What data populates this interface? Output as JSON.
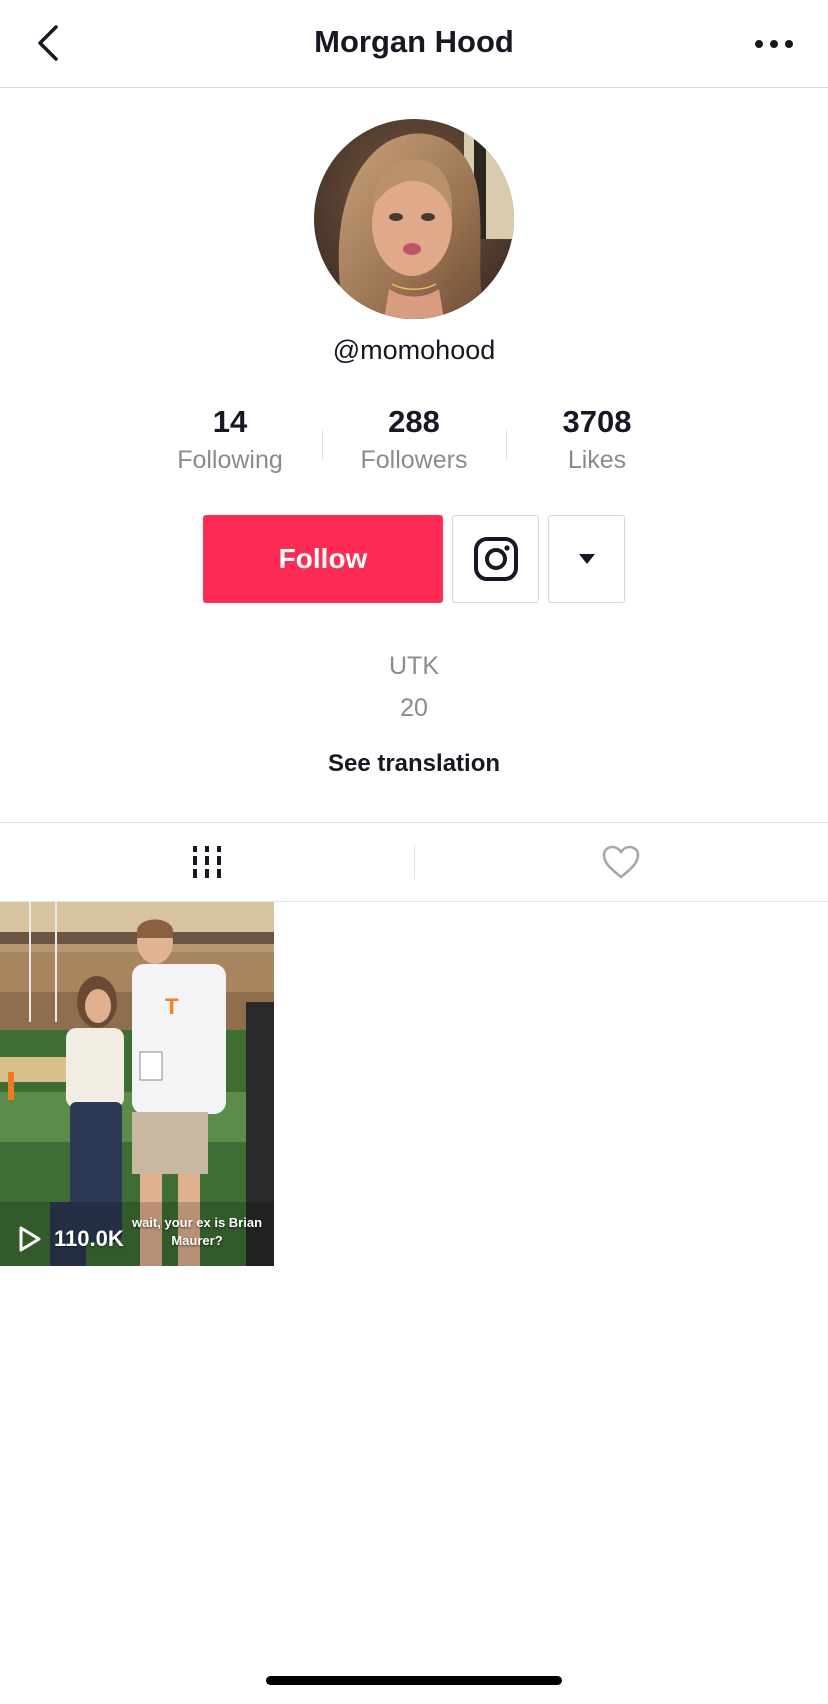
{
  "header": {
    "title": "Morgan Hood",
    "back_icon": "chevron-left-icon",
    "more_icon": "more-horizontal-icon"
  },
  "profile": {
    "username": "@momohood",
    "avatar_icon": "profile-photo"
  },
  "stats": [
    {
      "count": "14",
      "label": "Following"
    },
    {
      "count": "288",
      "label": "Followers"
    },
    {
      "count": "3708",
      "label": "Likes"
    }
  ],
  "actions": {
    "follow_label": "Follow",
    "follow_color": "#fe2c55",
    "instagram_icon": "instagram-icon",
    "dropdown_icon": "triangle-down-icon"
  },
  "bio": {
    "lines": [
      "UTK",
      "20"
    ],
    "see_translation": "See translation"
  },
  "tabs": [
    {
      "name": "videos",
      "icon": "grid-icon",
      "active": true
    },
    {
      "name": "liked",
      "icon": "heart-outline-icon",
      "active": false
    }
  ],
  "videos": [
    {
      "views": "110.0K",
      "caption": "wait, your ex is Brian Maurer?"
    }
  ]
}
